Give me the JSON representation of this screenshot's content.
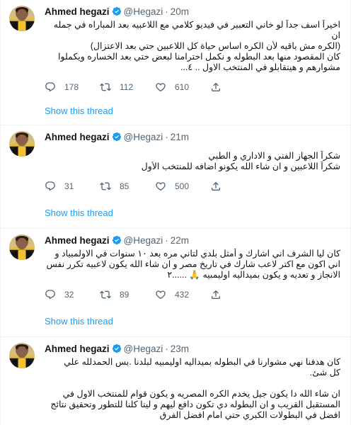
{
  "author": {
    "name": "Ahmed hegazi",
    "handle": "@Hegazi"
  },
  "colors": {
    "link": "#1d9bf0",
    "muted": "#536471",
    "verified": "#1d9bf0"
  },
  "show_thread_label": "Show this thread",
  "tweets": [
    {
      "time": "20m",
      "lines": [
        "اخيراً اسف جداً لو خاني التعبير في فيديو كلامي مع اللاعبيه بعد المباراه في جمله",
        "ان",
        "(الكره مش باقيه لأن الكره اساس حياة كل اللاعبين حتي بعد الاعتزال)",
        "كان المقصود منها بعد البطوله و نكمل احترامنا لبعض حتي بعد الخساره ويكملوا",
        "مشوارهم و هيتقابلو في المنتخب الاول .. ٤..."
      ],
      "replies": "178",
      "retweets": "112",
      "likes": "610"
    },
    {
      "time": "21m",
      "lines": [
        "شكراً الجهاز الفني و الاداري و الطبي",
        "شكراً اللاعبين و ان شاء الله يكونو اضافه للمنتخب الأول"
      ],
      "replies": "31",
      "retweets": "85",
      "likes": "500"
    },
    {
      "time": "22m",
      "lines": [
        "كان ليا الشرف اني اشارك و أمثل بلدي لتاني مره بعد ١٠ سنوات في الاولمبياد و",
        "اني اكون مع اكتر لاعب شارك في تاريخ مصر و ان شاء الله يكون لاعبيه تكرر نفس",
        "الانجاز و تعديه و يكون بميداليه اوليمبيه 🙏 ......٢"
      ],
      "replies": "32",
      "retweets": "89",
      "likes": "432"
    },
    {
      "time": "23m",
      "lines": [
        "كان هدفنا نهي مشوارنا في البطوله بميداليه اوليمبيه لبلدنا .بس الحمدلله علي",
        "كل شئ.",
        "",
        "ان شاء الله دا يكون جيل يخدم الكره المصريه و يكون قوام للمنتخب الاول  في",
        "المستقبل القريب و ان البطوله دي تكون دافع ليهم و لينا كلنا للتطور  وتحقيق نتائج",
        "افضل في البطولات الكبري حتي امام افضل الفرق"
      ],
      "replies": "",
      "retweets": "",
      "likes": ""
    }
  ]
}
